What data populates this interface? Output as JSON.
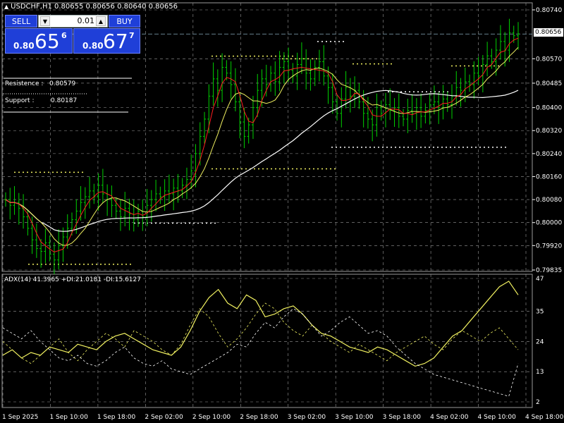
{
  "header": {
    "symbol_line": "USDCHF,H1  0.80655 0.80656 0.80640 0.80656"
  },
  "trade_panel": {
    "sell_label": "SELL",
    "buy_label": "BUY",
    "lot": "0.01",
    "sell_price": {
      "prefix": "0.80",
      "big": "65",
      "sup": "6"
    },
    "buy_price": {
      "prefix": "0.80",
      "big": "67",
      "sup": "7"
    }
  },
  "levels_info": {
    "resistance_label": "Resistence :",
    "resistance_value": "0.80579",
    "support_label": "Support   :",
    "support_value": "0.80187"
  },
  "adx_title": "ADX(14) 41.3965 +DI:21.0181 -DI:15.6127",
  "current_price_tag": "0.80656",
  "colors": {
    "background": "#000000",
    "grid": "#9a9a9a",
    "candle": "#00d000",
    "ma_fast": "#ff2020",
    "ma_mid": "#f0f060",
    "ma_slow": "#ffffff",
    "level_lines": "#f0f060",
    "level_lines_alt": "#ffffff",
    "panel_blue": "#1f3fd8"
  },
  "chart_data": [
    {
      "type": "candlestick",
      "title": "USDCHF,H1",
      "yticks": [
        "0.80740",
        "0.80656",
        "0.80570",
        "0.80485",
        "0.80400",
        "0.80320",
        "0.80240",
        "0.80160",
        "0.80080",
        "0.80000",
        "0.79920",
        "0.79835"
      ],
      "ylim": [
        0.79835,
        0.8074
      ],
      "xticks": [
        "1 Sep 2025",
        "1 Sep 10:00",
        "1 Sep 18:00",
        "2 Sep 02:00",
        "2 Sep 10:00",
        "2 Sep 18:00",
        "3 Sep 02:00",
        "3 Sep 10:00",
        "3 Sep 18:00",
        "4 Sep 02:00",
        "4 Sep 10:00",
        "4 Sep 18:00"
      ],
      "closes": [
        0.8008,
        0.8006,
        0.8007,
        0.8005,
        0.8002,
        0.7998,
        0.7994,
        0.7991,
        0.799,
        0.7993,
        0.7989,
        0.7987,
        0.7992,
        0.7995,
        0.7998,
        0.8001,
        0.8004,
        0.8007,
        0.8009,
        0.8011,
        0.8009,
        0.8013,
        0.801,
        0.8008,
        0.8006,
        0.8004,
        0.8002,
        0.8005,
        0.8003,
        0.8001,
        0.8004,
        0.8002,
        0.8006,
        0.8008,
        0.801,
        0.8009,
        0.8011,
        0.801,
        0.8012,
        0.8011,
        0.8013,
        0.8015,
        0.8018,
        0.8024,
        0.803,
        0.8036,
        0.8044,
        0.805,
        0.8046,
        0.8054,
        0.8052,
        0.8048,
        0.8042,
        0.8035,
        0.803,
        0.8034,
        0.804,
        0.8046,
        0.805,
        0.8048,
        0.8052,
        0.8049,
        0.8054,
        0.8056,
        0.8053,
        0.8051,
        0.8055,
        0.8057,
        0.8052,
        0.805,
        0.8054,
        0.8056,
        0.8051,
        0.8047,
        0.8042,
        0.8038,
        0.8043,
        0.8047,
        0.8044,
        0.8046,
        0.8042,
        0.8038,
        0.8036,
        0.8034,
        0.804,
        0.8038,
        0.8041,
        0.8039,
        0.804,
        0.8037,
        0.8036,
        0.8039,
        0.8038,
        0.804,
        0.8037,
        0.8039,
        0.8041,
        0.8042,
        0.804,
        0.8043,
        0.8041,
        0.8044,
        0.8047,
        0.8046,
        0.8049,
        0.8048,
        0.8052,
        0.8051,
        0.8055,
        0.8058,
        0.8056,
        0.806,
        0.8063,
        0.806,
        0.8066,
        0.8065,
        0.8065656
      ],
      "series": [
        {
          "name": "MA fast",
          "color": "red"
        },
        {
          "name": "MA mid",
          "color": "yellow"
        },
        {
          "name": "MA slow",
          "color": "white"
        }
      ],
      "levels": {
        "resistance": 0.80579,
        "support": 0.80187
      }
    },
    {
      "type": "line",
      "title": "ADX(14) 41.3965 +DI:21.0181 -DI:15.6127",
      "yticks": [
        "47",
        "35",
        "24",
        "13",
        "2"
      ],
      "ylim": [
        2,
        47
      ],
      "series": [
        {
          "name": "ADX",
          "values": [
            19,
            21,
            18,
            20,
            19,
            22,
            21,
            20,
            23,
            22,
            21,
            24,
            26,
            27,
            25,
            23,
            21,
            20,
            19,
            22,
            28,
            35,
            40,
            43,
            38,
            36,
            41,
            39,
            33,
            34,
            36,
            37,
            34,
            30,
            27,
            26,
            24,
            22,
            21,
            20,
            22,
            21,
            19,
            17,
            15,
            16,
            18,
            22,
            26,
            28,
            32,
            36,
            40,
            44,
            46,
            41
          ]
        },
        {
          "name": "+DI",
          "values": [
            24,
            21,
            18,
            16,
            19,
            22,
            25,
            20,
            17,
            21,
            24,
            27,
            25,
            22,
            28,
            26,
            24,
            21,
            19,
            23,
            30,
            36,
            33,
            27,
            22,
            25,
            29,
            34,
            38,
            36,
            31,
            28,
            26,
            30,
            27,
            24,
            22,
            20,
            23,
            21,
            19,
            17,
            20,
            22,
            24,
            26,
            23,
            21,
            25,
            28,
            26,
            24,
            27,
            29,
            25,
            21
          ]
        },
        {
          "name": "-DI",
          "values": [
            29,
            27,
            25,
            28,
            24,
            21,
            18,
            17,
            19,
            16,
            15,
            17,
            20,
            22,
            18,
            16,
            15,
            17,
            14,
            13,
            12,
            14,
            16,
            18,
            20,
            23,
            22,
            27,
            31,
            29,
            33,
            36,
            34,
            30,
            26,
            28,
            31,
            33,
            30,
            27,
            28,
            26,
            22,
            19,
            16,
            14,
            12,
            11,
            10,
            9,
            8,
            7,
            6,
            5,
            4,
            16
          ]
        }
      ]
    }
  ]
}
